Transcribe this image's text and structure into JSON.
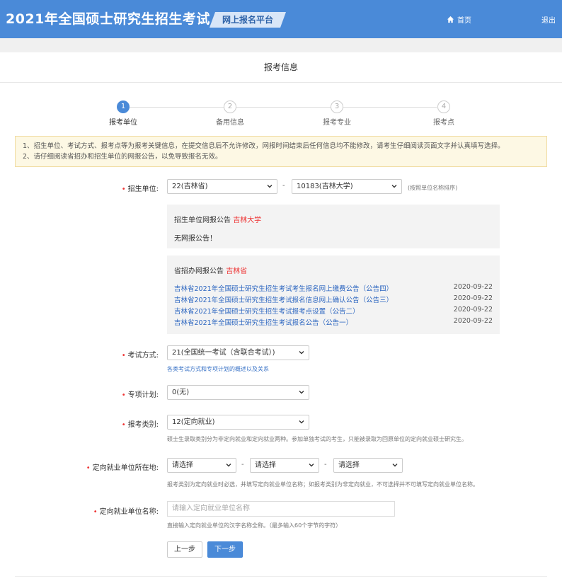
{
  "header": {
    "title": "2021年全国硕士研究生招生考试",
    "platform": "网上报名平台",
    "home": "首页",
    "logout": "退出"
  },
  "panel": {
    "title": "报考信息"
  },
  "steps": [
    {
      "num": "1",
      "label": "报考单位"
    },
    {
      "num": "2",
      "label": "备用信息"
    },
    {
      "num": "3",
      "label": "报考专业"
    },
    {
      "num": "4",
      "label": "报考点"
    }
  ],
  "notice": {
    "line1": "1、招生单位、考试方式、报考点等为报考关键信息，在提交信息后不允许修改，网报时间结束后任何信息均不能修改，请考生仔细阅读页面文字并认真填写选择。",
    "line2": "2、请仔细阅读省招办和招生单位的网报公告，以免导致报名无效。"
  },
  "form": {
    "unit": {
      "label": "招生单位:",
      "province": "22(吉林省)",
      "school": "10183(吉林大学)",
      "hint": "(按照单位名称排序)"
    },
    "unit_notice": {
      "title": "招生单位网报公告",
      "school_name": "吉林大学",
      "text": "无网报公告！"
    },
    "province_notice": {
      "title": "省招办网报公告",
      "province_name": "吉林省",
      "items": [
        {
          "text": "吉林省2021年全国硕士研究生招生考试考生报名网上缴费公告（公告四）",
          "date": "2020-09-22"
        },
        {
          "text": "吉林省2021年全国硕士研究生招生考试报名信息网上确认公告（公告三）",
          "date": "2020-09-22"
        },
        {
          "text": "吉林省2021年全国硕士研究生招生考试报考点设置（公告二）",
          "date": "2020-09-22"
        },
        {
          "text": "吉林省2021年全国硕士研究生招生考试报名公告（公告一）",
          "date": "2020-09-22"
        }
      ]
    },
    "exam_method": {
      "label": "考试方式:",
      "value": "21(全国统一考试（含联合考试）)",
      "hint": "各类考试方式和专项计划的概述以及关系"
    },
    "special_plan": {
      "label": "专项计划:",
      "value": "0(无)"
    },
    "category": {
      "label": "报考类别:",
      "value": "12(定向就业)",
      "hint": "硕士生录取类别分为非定向就业和定向就业两种。参加单独考试的考生，只能被录取为回原单位的定向就业硕士研究生。"
    },
    "employer_location": {
      "label": "定向就业单位所在地:",
      "options": [
        "请选择",
        "请选择",
        "请选择"
      ],
      "hint": "报考类别为定向就业时必选，并填写定向就业单位名称；如报考类别为非定向就业，不可选择并不可填写定向就业单位名称。"
    },
    "employer_name": {
      "label": "定向就业单位名称:",
      "placeholder": "请输入定向就业单位名称",
      "hint": "直接输入定向就业单位的汉字名称全称。（最多输入60个字节的字符）"
    },
    "dash": "-"
  },
  "buttons": {
    "prev": "上一步",
    "next": "下一步"
  },
  "colors": {
    "header": "#4a8ad8",
    "link": "#2b65c0",
    "required": "#e33333"
  }
}
